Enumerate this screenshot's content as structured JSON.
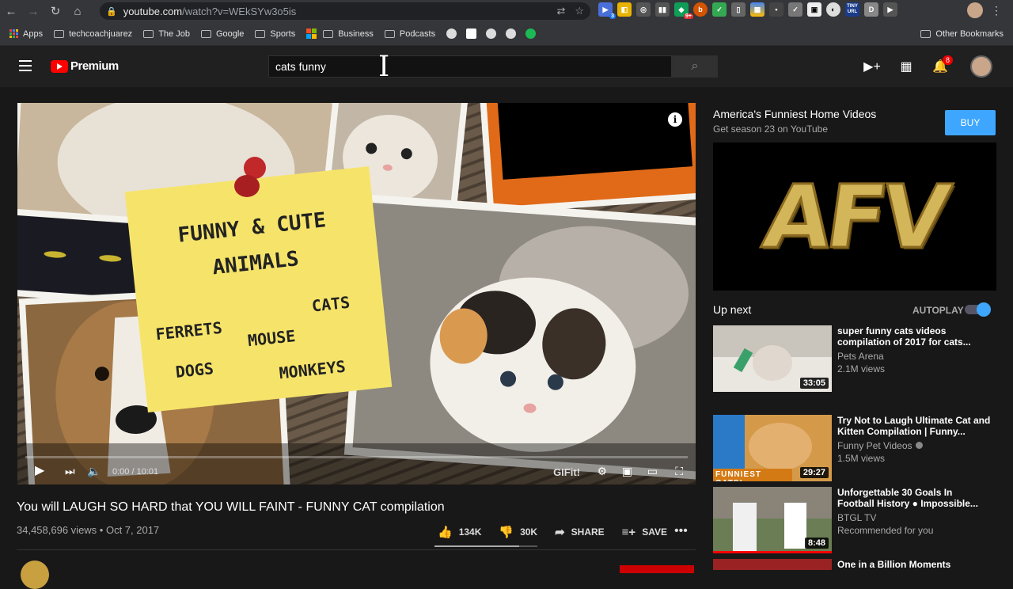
{
  "browser": {
    "url_host": "youtube.com",
    "url_path": "/watch?v=WEkSYw3o5is",
    "bookmarks": [
      {
        "label": "Apps",
        "type": "apps"
      },
      {
        "label": "techcoachjuarez",
        "type": "folder"
      },
      {
        "label": "The Job",
        "type": "folder"
      },
      {
        "label": "Google",
        "type": "folder"
      },
      {
        "label": "Sports",
        "type": "folder"
      },
      {
        "label": "Business",
        "type": "folder"
      },
      {
        "label": "Podcasts",
        "type": "folder"
      }
    ],
    "other_bookmarks": "Other Bookmarks",
    "extension_badges": [
      "3",
      "9+"
    ],
    "tiny_url_label": "TINY URL",
    "ext_d_label": "D"
  },
  "header": {
    "logo_text": "Premium",
    "search_value": "cats funny",
    "notification_count": "8"
  },
  "player": {
    "time": "0:00 / 10:01",
    "gif_label": "GIFit!",
    "info_icon": "i",
    "progress": 0
  },
  "thumbnail": {
    "note_line1": "FUNNY & CUTE",
    "note_line2": "ANIMALS",
    "ferrets": "FERRETS",
    "cats": "CATS",
    "mouse": "MOUSE",
    "dogs": "DOGS",
    "monkeys": "MONKEYS"
  },
  "video": {
    "title": "You will LAUGH SO HARD that YOU WILL FAINT - FUNNY CAT compilation",
    "meta": "34,458,696 views • Oct 7, 2017",
    "likes": "134K",
    "dislikes": "30K",
    "share_label": "SHARE",
    "save_label": "SAVE"
  },
  "ad": {
    "title": "America's Funniest Home Videos",
    "subtitle": "Get season 23 on YouTube",
    "buy_label": "BUY",
    "banner_text": "AFV"
  },
  "sidebar": {
    "upnext_label": "Up next",
    "autoplay_label": "AUTOPLAY",
    "autoplay_on": true,
    "items": [
      {
        "title": "super funny cats videos compilation of 2017 for cats...",
        "channel": "Pets Arena",
        "views": "2.1M views",
        "duration": "33:05",
        "verified": false,
        "thumb_color": "#c9c4bc"
      },
      {
        "title": "Try Not to Laugh Ultimate Cat and Kitten Compilation | Funny...",
        "channel": "Funny Pet Videos",
        "views": "1.5M views",
        "duration": "29:27",
        "verified": true,
        "thumb_color": "#d49a4a",
        "thumb_text": "FUNNIEST CATS!"
      },
      {
        "title": "Unforgettable 30 Goals In Football History ● Impossible...",
        "channel": "BTGL TV",
        "views": "Recommended for you",
        "duration": "8:48",
        "verified": false,
        "thumb_color": "#6a7d55"
      },
      {
        "title": "One in a Billion Moments",
        "channel": "",
        "views": "",
        "duration": "",
        "verified": false,
        "thumb_color": "#9a2222"
      }
    ]
  },
  "colors": {
    "accent_blue": "#3ea6ff",
    "yt_red": "#ff0000",
    "bg": "#181818"
  }
}
